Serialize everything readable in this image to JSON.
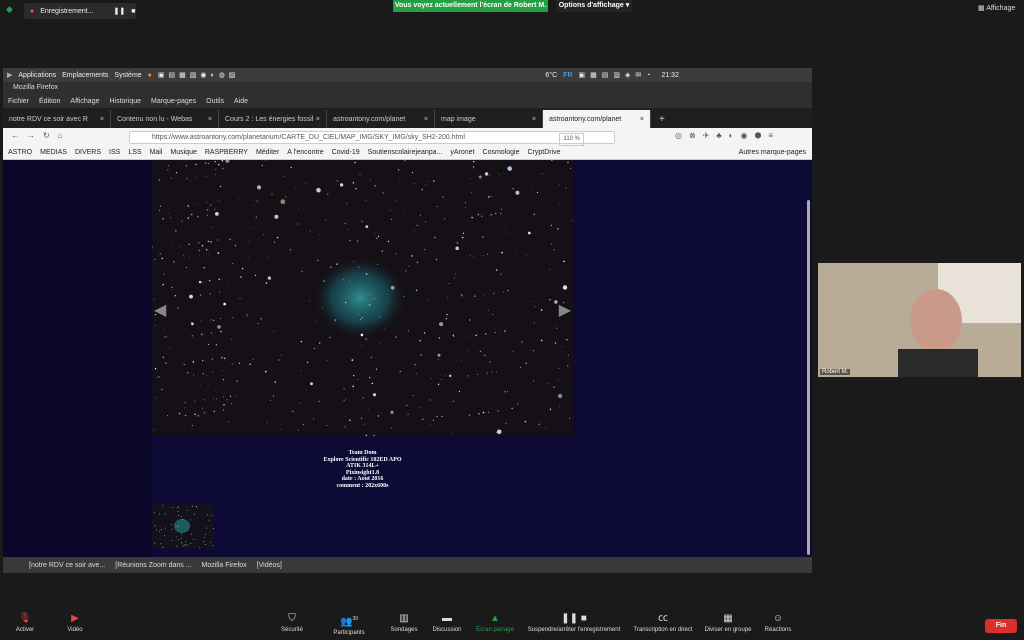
{
  "zoom": {
    "recording_label": "Enregistrement...",
    "share_banner": "Vous voyez actuellement l'écran de Robert M.",
    "view_options": "Options d'affichage",
    "view_label": "Affichage",
    "participant_name": "Robert M.",
    "participants_count": "30",
    "toolbar": [
      {
        "id": "mute",
        "label": "Activer",
        "icon": "microphone-muted-icon"
      },
      {
        "id": "video",
        "label": "Vidéo",
        "icon": "camera-off-icon"
      },
      {
        "id": "security",
        "label": "Sécurité",
        "icon": "shield-icon"
      },
      {
        "id": "participants",
        "label": "Participants",
        "icon": "participants-icon"
      },
      {
        "id": "polls",
        "label": "Sondages",
        "icon": "bar-chart-icon"
      },
      {
        "id": "chat",
        "label": "Discussion",
        "icon": "chat-icon"
      },
      {
        "id": "share",
        "label": "Écran partagé",
        "icon": "share-screen-icon"
      },
      {
        "id": "record",
        "label": "Suspendre/arrêter l'enregistrement",
        "icon": "pause-stop-icon"
      },
      {
        "id": "captions",
        "label": "Transcription en direct",
        "icon": "cc-icon"
      },
      {
        "id": "breakout",
        "label": "Diviser en groupe",
        "icon": "grid-icon"
      },
      {
        "id": "reactions",
        "label": "Réactions",
        "icon": "smile-icon"
      }
    ],
    "end_label": "Fin",
    "colors": {
      "share_green": "#23a044",
      "end_red": "#d9302c"
    }
  },
  "desktop": {
    "panel_items": [
      "Applications",
      "Emplacements",
      "Système"
    ],
    "clock": "21:32",
    "weather": "6°C",
    "lang": "FR",
    "taskbar": [
      "[notre RDV ce soir ave...",
      "[Réunions Zoom dans ...",
      "Mozilla Firefox",
      "[Vidéos]"
    ]
  },
  "firefox": {
    "title": "Mozilla Firefox",
    "menu": [
      "Fichier",
      "Édition",
      "Affichage",
      "Historique",
      "Marque-pages",
      "Outils",
      "Aide"
    ],
    "tabs": [
      {
        "label": "notre RDV ce soir avec R",
        "active": false
      },
      {
        "label": "Contenu non lu - Webas",
        "active": false
      },
      {
        "label": "Cours 2 : Les énergies fossil",
        "active": false
      },
      {
        "label": "astroantony.com/planet",
        "active": false
      },
      {
        "label": "map image",
        "active": false
      },
      {
        "label": "astroantony.com/planet",
        "active": true
      }
    ],
    "url": "https://www.astroantony.com/planetarium/CARTE_DU_CIEL/MAP_IMG/SKY_IMG/sky_SH2-200.html",
    "zoom": "110 %",
    "bookmarks": [
      "ASTRO",
      "MEDIAS",
      "DIVERS",
      "ISS",
      "LSS",
      "Mail",
      "Musique",
      "RASPBERRY",
      "Méditer",
      "A l'encontre",
      "Covid-19",
      "Soutienscolairejeanpa...",
      "yAronet",
      "Cosmologie",
      "CryptDrive",
      "Autres marque-pages"
    ]
  },
  "page": {
    "info_lines": [
      "Team Dom",
      "Explore Scientific 102ED APO",
      "ATIK 314L+",
      "Pixinsight1.8",
      "date : Aout 2016",
      "comment : 202x600s"
    ]
  }
}
